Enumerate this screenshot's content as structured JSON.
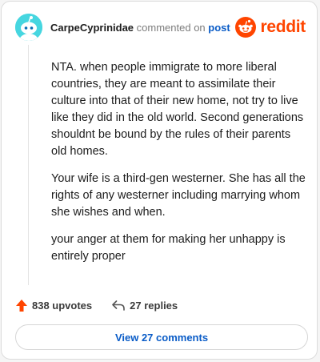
{
  "header": {
    "username": "CarpeCyprinidae",
    "commented_on": "commented on",
    "post_link": "post",
    "brand": "reddit"
  },
  "comment": {
    "paragraphs": [
      "NTA. when people immigrate to more liberal countries, they are meant to assimilate their culture into that of their new home, not try to live like they did in the old world. Second generations shouldnt be bound by the rules of their parents old homes.",
      "Your wife is a third-gen westerner. She has all the rights of any westerner including marrying whom she wishes and when.",
      "your anger at them for making her unhappy is entirely proper"
    ]
  },
  "actions": {
    "upvotes": "838 upvotes",
    "replies": "27 replies"
  },
  "footer": {
    "view_comments": "View 27 comments"
  },
  "colors": {
    "accent": "#ff4500",
    "link": "#0a5cc7",
    "avatar_bg": "#46d6e0"
  }
}
